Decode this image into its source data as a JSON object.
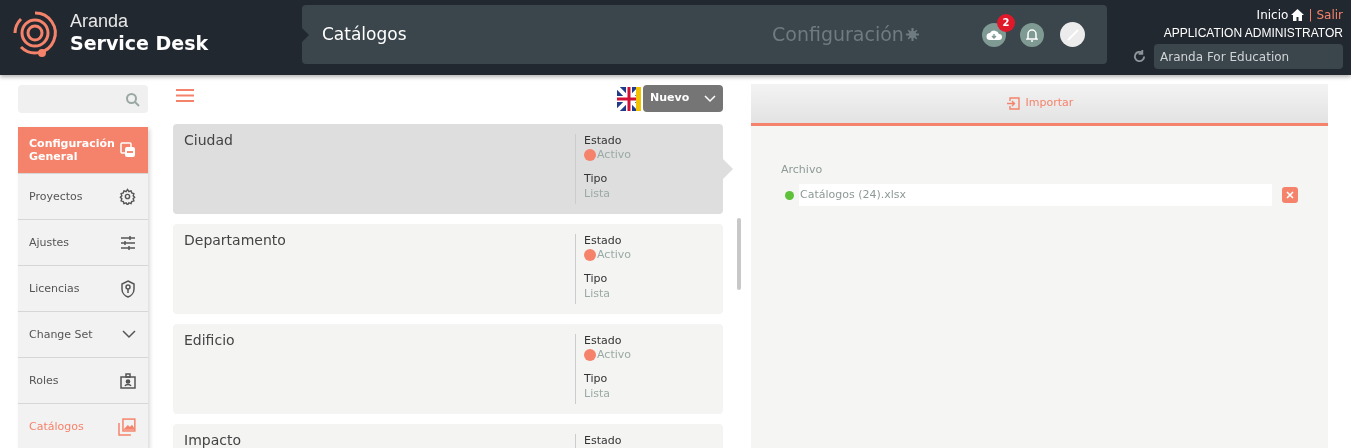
{
  "header": {
    "brand_top": "Aranda",
    "brand_bottom": "Service Desk",
    "page_title": "Catálogos",
    "section": "Configuración",
    "download_count": "2",
    "home_link": "Inicio",
    "separator": "|",
    "logout_link": "Salir",
    "user": "APPLICATION ADMINISTRATOR",
    "project": "Aranda For Education"
  },
  "sidebar": {
    "items": [
      {
        "label": "Configuración General",
        "kind": "header",
        "selected": true
      },
      {
        "label": "Proyectos",
        "kind": "item",
        "selected": false
      },
      {
        "label": "Ajustes",
        "kind": "item",
        "selected": false
      },
      {
        "label": "Licencias",
        "kind": "item",
        "selected": false
      },
      {
        "label": "Change Set",
        "kind": "item",
        "selected": false
      },
      {
        "label": "Roles",
        "kind": "item",
        "selected": false
      },
      {
        "label": "Catálogos",
        "kind": "item",
        "selected": true
      }
    ]
  },
  "toolbar": {
    "new_button": "Nuevo"
  },
  "catalogs": [
    {
      "name": "Ciudad",
      "selected": true,
      "state_label": "Estado",
      "state": "Activo",
      "type_label": "Tipo",
      "type": "Lista"
    },
    {
      "name": "Departamento",
      "selected": false,
      "state_label": "Estado",
      "state": "Activo",
      "type_label": "Tipo",
      "type": "Lista"
    },
    {
      "name": "Edificio",
      "selected": false,
      "state_label": "Estado",
      "state": "Activo",
      "type_label": "Tipo",
      "type": "Lista"
    },
    {
      "name": "Impacto",
      "selected": false,
      "state_label": "Estado"
    }
  ],
  "import_panel": {
    "tab": "Importar",
    "file_label": "Archivo",
    "file_name": "Catálogos (24).xlsx"
  }
}
